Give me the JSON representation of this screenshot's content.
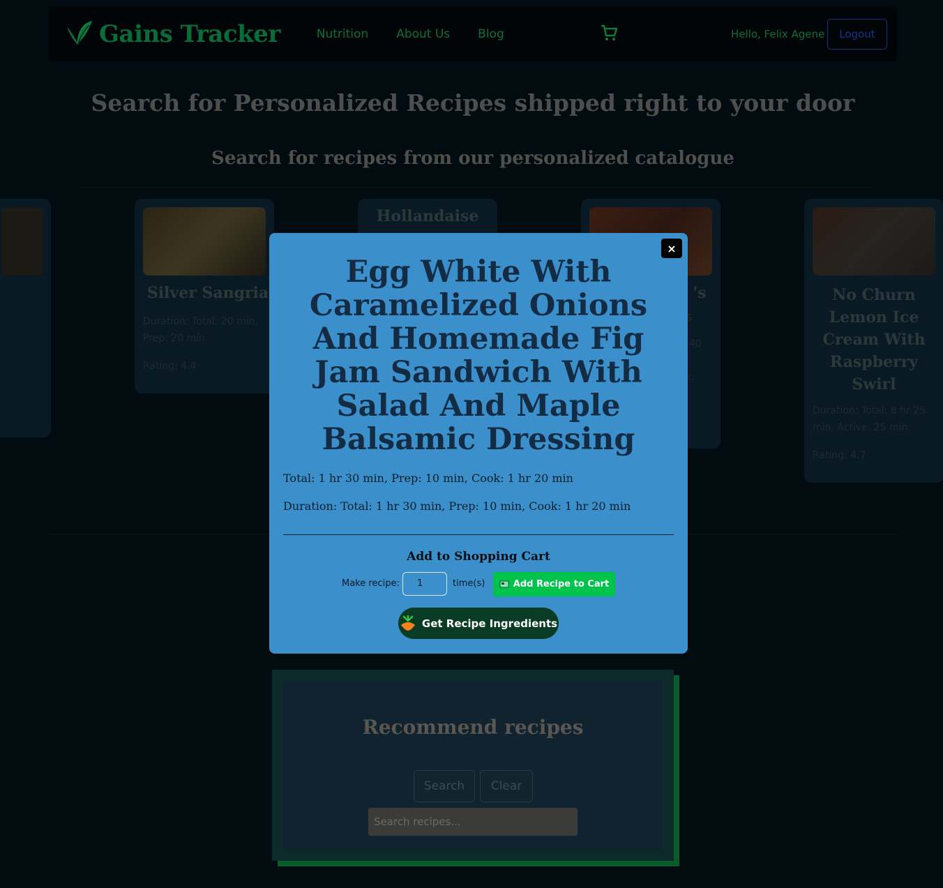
{
  "navbar": {
    "brand": "Gains Tracker",
    "links": [
      "Nutrition",
      "About Us",
      "Blog"
    ],
    "greeting": "Hello, Felix Agene",
    "logout_label": "Logout"
  },
  "hero": {
    "title": "Search for Personalized Recipes shipped right to your door"
  },
  "catalogue": {
    "subtitle": "Search for recipes from our personalized catalogue",
    "cards": [
      {
        "title": "Silver Sangria",
        "duration": "Duration: Total: 20 min, Prep: 20 min",
        "rating": "Rating: 4.4"
      },
      {
        "title": "Hollandaise"
      },
      {
        "title_partial": "'s",
        "frag1": "s",
        "frag2": "40",
        "frag3": "k:"
      },
      {
        "title": "No Churn Lemon Ice Cream With Raspberry Swirl",
        "duration": "Duration: Total: 8 hr 25 min, Active: 25 min",
        "rating": "Rating: 4.7"
      }
    ]
  },
  "recommend": {
    "title": "Recommend recipes",
    "search_label": "Search",
    "clear_label": "Clear",
    "input_placeholder": "Search recipes..."
  },
  "modal": {
    "close_label": "×",
    "title": "Egg White With Caramelized Onions And Homemade Fig Jam Sandwich With Salad And Maple Balsamic Dressing",
    "time_line": "Total: 1 hr 30 min, Prep: 10 min, Cook: 1 hr 20 min",
    "duration_line": "Duration: Total: 1 hr 30 min, Prep: 10 min, Cook: 1 hr 20 min",
    "cart_heading": "Add to Shopping Cart",
    "make_label": "Make recipe:",
    "quantity": "1",
    "times_label": "time(s)",
    "add_cart_label": "Add Recipe to Cart",
    "ingredients_label": "Get Recipe Ingredients"
  },
  "colors": {
    "brand_green": "#0b6b39",
    "modal_bg": "#3b8fcb",
    "add_cart_green": "#00c34b",
    "ingredients_bg": "#0a3b24"
  },
  "icons": [
    "leaf-logo-icon",
    "shopping-cart-icon",
    "close-icon",
    "cart-small-icon",
    "carrot-icon"
  ]
}
